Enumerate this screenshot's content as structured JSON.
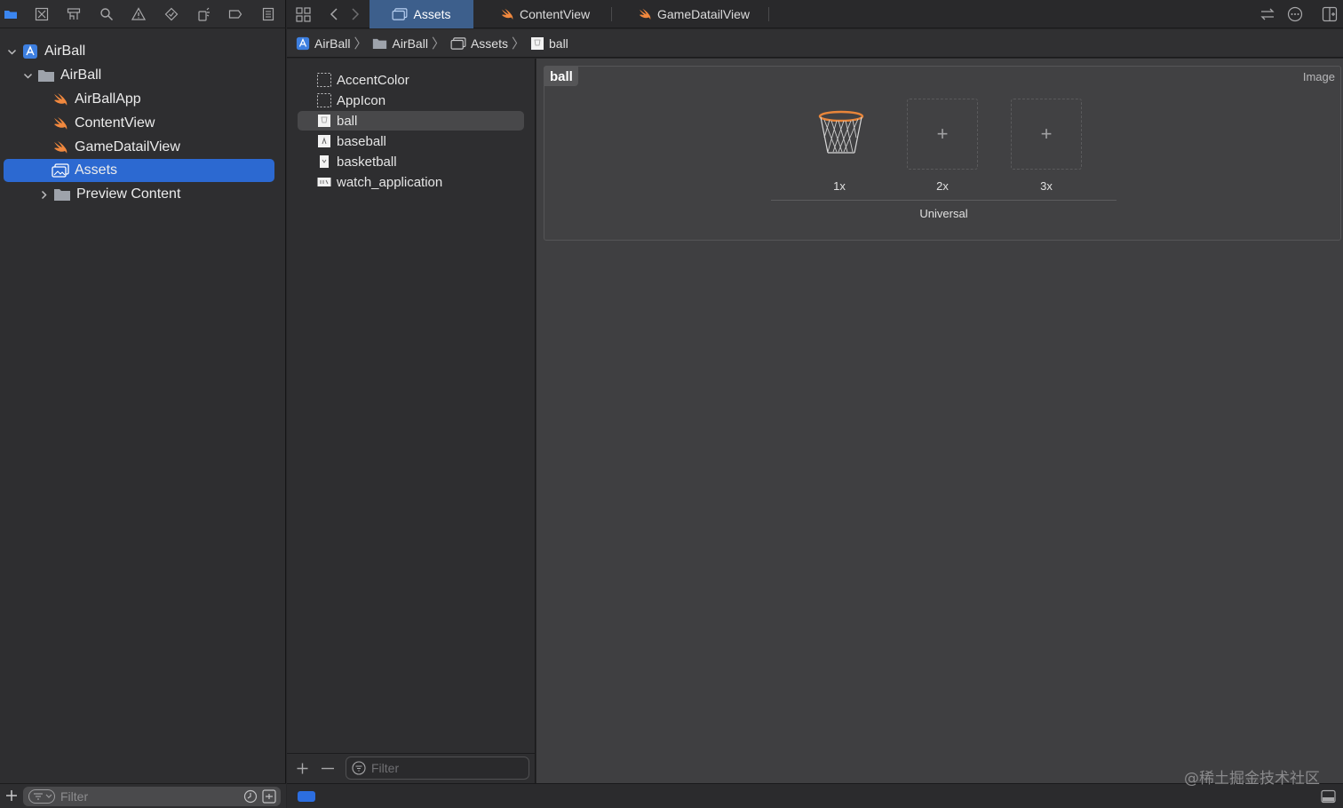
{
  "navigator": {
    "tools": [
      "folder-icon",
      "source-control-icon",
      "hierarchy-icon",
      "search-icon",
      "warning-icon",
      "test-icon",
      "debug-icon",
      "breakpoint-icon",
      "report-icon"
    ],
    "tree": [
      {
        "label": "AirBall",
        "icon": "project-icon",
        "expanded": true
      },
      {
        "label": "AirBall",
        "icon": "folder-icon",
        "expanded": true
      },
      {
        "label": "AirBallApp",
        "icon": "swift-file-icon"
      },
      {
        "label": "ContentView",
        "icon": "swift-file-icon"
      },
      {
        "label": "GameDatailView",
        "icon": "swift-file-icon"
      },
      {
        "label": "Assets",
        "icon": "asset-catalog-icon",
        "selected": true
      },
      {
        "label": "Preview Content",
        "icon": "folder-icon",
        "expanded": false
      }
    ],
    "filter_placeholder": "Filter"
  },
  "tabs": [
    {
      "label": "Assets",
      "icon": "asset-catalog-icon",
      "active": true
    },
    {
      "label": "ContentView",
      "icon": "swift-file-icon"
    },
    {
      "label": "GameDatailView",
      "icon": "swift-file-icon"
    }
  ],
  "breadcrumb": [
    {
      "label": "AirBall",
      "icon": "project-icon"
    },
    {
      "label": "AirBall",
      "icon": "folder-icon"
    },
    {
      "label": "Assets",
      "icon": "asset-catalog-icon"
    },
    {
      "label": "ball",
      "icon": "image-set-icon"
    }
  ],
  "assets": {
    "items": [
      {
        "label": "AccentColor",
        "icon": "color-set-icon"
      },
      {
        "label": "AppIcon",
        "icon": "app-icon-set-icon"
      },
      {
        "label": "ball",
        "icon": "image-set-icon",
        "selected": true
      },
      {
        "label": "baseball",
        "icon": "image-set-icon"
      },
      {
        "label": "basketball",
        "icon": "image-set-icon"
      },
      {
        "label": "watch_application",
        "icon": "image-set-icon"
      }
    ],
    "filter_placeholder": "Filter"
  },
  "editor": {
    "set_name": "ball",
    "set_type": "Image",
    "slots": [
      {
        "label": "1x",
        "filled": true,
        "image": "basketball-hoop-icon"
      },
      {
        "label": "2x",
        "filled": false
      },
      {
        "label": "3x",
        "filled": false
      }
    ],
    "slot_group_label": "Universal"
  },
  "watermark": "@稀土掘金技术社区",
  "colors": {
    "accent": "#2c69d1",
    "active_tab": "#3d5f8c",
    "swift": "#f0883e"
  }
}
